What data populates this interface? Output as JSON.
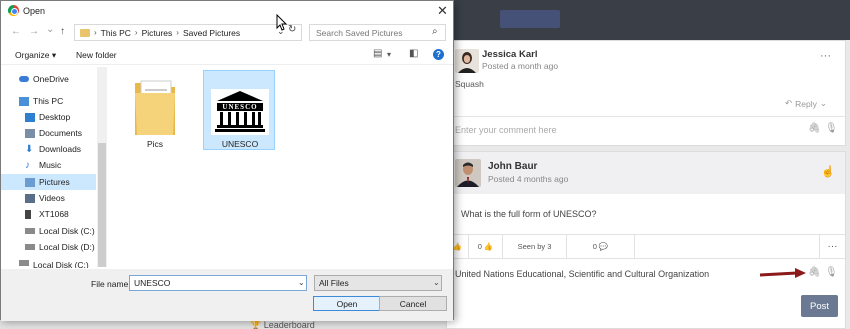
{
  "dialog": {
    "title": "Open",
    "close": "✕",
    "nav": {
      "back": "←",
      "forward": "→",
      "recent": "⌄",
      "up": "↑"
    },
    "breadcrumb": [
      "This PC",
      "Pictures",
      "Saved Pictures"
    ],
    "crumb_sep": "›",
    "search_placeholder": "Search Saved Pictures",
    "toolbar": {
      "organize": "Organize ▾",
      "new_folder": "New folder",
      "help": "?"
    },
    "nav_pane": [
      {
        "label": "OneDrive",
        "icon": "cloud-icon",
        "color": "#3a7bd5"
      },
      {
        "label": "This PC",
        "icon": "computer-icon",
        "color": "#4a90d9"
      },
      {
        "label": "Desktop",
        "icon": "desktop-icon",
        "color": "#2f7fd1"
      },
      {
        "label": "Documents",
        "icon": "documents-icon",
        "color": "#7a8ea8"
      },
      {
        "label": "Downloads",
        "icon": "downloads-icon",
        "color": "#2f7fd1"
      },
      {
        "label": "Music",
        "icon": "music-icon",
        "color": "#2f7fd1"
      },
      {
        "label": "Pictures",
        "icon": "pictures-icon",
        "color": "#6a9bd1",
        "selected": true
      },
      {
        "label": "Videos",
        "icon": "videos-icon",
        "color": "#5a6e8a"
      },
      {
        "label": "XT1068",
        "icon": "phone-icon",
        "color": "#444"
      },
      {
        "label": "Local Disk (C:)",
        "icon": "disk-icon",
        "color": "#8a8a8a"
      },
      {
        "label": "Local Disk (D:)",
        "icon": "disk-icon",
        "color": "#8a8a8a"
      },
      {
        "label": "Local Disk (C:)",
        "icon": "disk-icon",
        "color": "#8a8a8a"
      }
    ],
    "files": [
      {
        "label": "Pics",
        "type": "folder"
      },
      {
        "label": "UNESCO",
        "type": "image",
        "logo_text": "UNESCO",
        "selected": true
      }
    ],
    "filename_label": "File name:",
    "filename_value": "UNESCO",
    "filetype_value": "All Files",
    "open_label": "Open",
    "cancel_label": "Cancel"
  },
  "background": {
    "comment1": {
      "author": "Jessica Karl",
      "posted": "Posted a month ago",
      "text": "Squash",
      "reply": "Reply",
      "more": "···"
    },
    "comment1_input_placeholder": "Enter your comment here",
    "post": {
      "author": "John Baur",
      "posted": "Posted 4 months ago",
      "question": "What is the full form of UNESCO?",
      "like_count": "0",
      "seen": "Seen by 3",
      "comments": "0",
      "more": "···"
    },
    "comment_input_value": "United Nations Educational, Scientific and Cultural Organization",
    "post_button": "Post",
    "leaderboard": "Leaderboard",
    "accent_arrow_color": "#8b1a1a"
  }
}
